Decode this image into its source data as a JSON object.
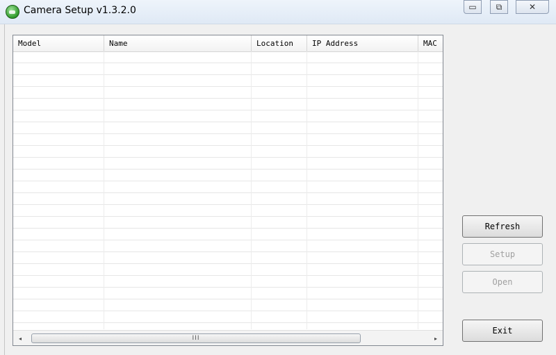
{
  "window": {
    "title": "Camera Setup v1.3.2.0",
    "controls": {
      "minimize": "▭",
      "maximize": "⧉",
      "close": "✕"
    }
  },
  "listview": {
    "columns": [
      "Model",
      "Name",
      "Location",
      "IP Address",
      "MAC"
    ]
  },
  "scrollbar": {
    "left_arrow": "◂",
    "right_arrow": "▸",
    "grip": "III"
  },
  "buttons": {
    "refresh": "Refresh",
    "setup": "Setup",
    "open": "Open",
    "exit": "Exit"
  },
  "colors": {
    "app_icon": "#2f9a2a",
    "disabled_text": "#a0a0a0"
  }
}
